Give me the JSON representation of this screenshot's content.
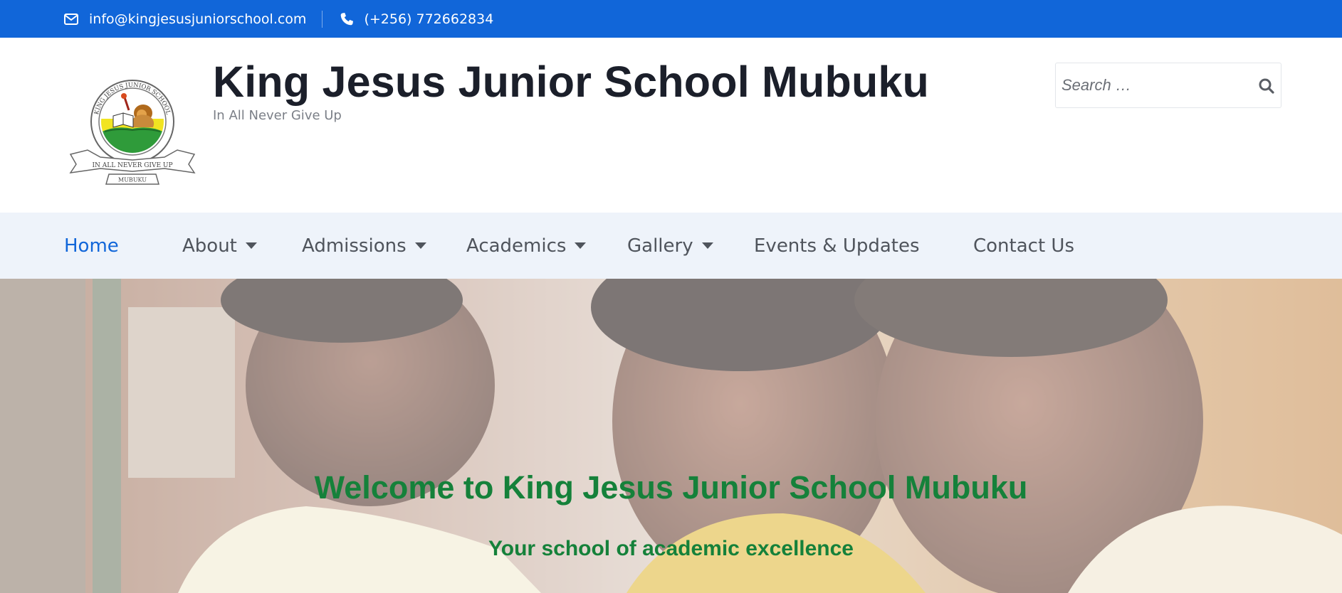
{
  "topbar": {
    "email": "info@kingjesusjuniorschool.com",
    "phone": "(+256) 772662834",
    "icons": {
      "email": "envelope-icon",
      "phone": "phone-icon"
    },
    "background_color": "#1166d9"
  },
  "header": {
    "site_title": "King Jesus Junior School Mubuku",
    "tagline": "In All Never Give Up",
    "logo": {
      "name": "school-crest-logo",
      "text_top": "KING JESUS JUNIOR SCHOOL",
      "text_ribbon": "IN ALL NEVER GIVE UP",
      "text_bottom": "MUBUKU"
    },
    "search": {
      "placeholder": "Search …",
      "value": "",
      "icon": "search-icon"
    }
  },
  "nav": {
    "items": [
      {
        "label": "Home",
        "active": true,
        "has_dropdown": false
      },
      {
        "label": "About",
        "active": false,
        "has_dropdown": true
      },
      {
        "label": "Admissions",
        "active": false,
        "has_dropdown": true
      },
      {
        "label": "Academics",
        "active": false,
        "has_dropdown": true
      },
      {
        "label": "Gallery",
        "active": false,
        "has_dropdown": true
      },
      {
        "label": "Events & Updates",
        "active": false,
        "has_dropdown": false
      },
      {
        "label": "Contact Us",
        "active": false,
        "has_dropdown": false
      }
    ],
    "active_color": "#1166d9",
    "background_color": "#eef3fa"
  },
  "hero": {
    "title": "Welcome to King Jesus Junior School Mubuku",
    "subtitle": "Your school of academic excellence",
    "text_color": "#15813a"
  }
}
